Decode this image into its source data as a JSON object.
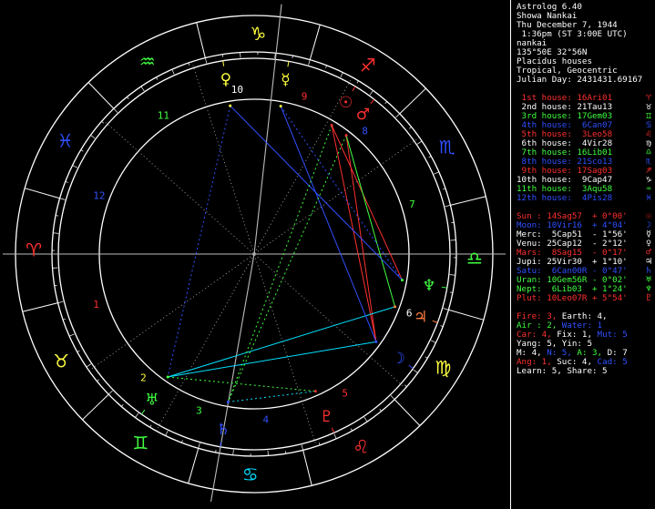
{
  "header": [
    "Astrolog 6.40",
    "Showa Nankai",
    "Thu December 7, 1944",
    " 1:36pm (ST 3:00E UTC)",
    "nankai",
    "135°50E 32°56N",
    "Placidus houses",
    "Tropical, Geocentric",
    "Julian Day: 2431431.69167"
  ],
  "houses": [
    {
      "text": " 1st house: 16Ari01",
      "color": "#ff3030",
      "glyph": "♈"
    },
    {
      "text": " 2nd house: 21Tau13",
      "color": "#ffffff",
      "glyph": "♉"
    },
    {
      "text": " 3rd house: 17Gem03",
      "color": "#40ff40",
      "glyph": "♊"
    },
    {
      "text": " 4th house:  6Can07",
      "color": "#3050ff",
      "glyph": "♋"
    },
    {
      "text": " 5th house:  3Leo58",
      "color": "#ff3030",
      "glyph": "♌"
    },
    {
      "text": " 6th house:  4Vir28",
      "color": "#ffffff",
      "glyph": "♍"
    },
    {
      "text": " 7th house: 16Lib01",
      "color": "#40ff40",
      "glyph": "♎"
    },
    {
      "text": " 8th house: 21Sco13",
      "color": "#3050ff",
      "glyph": "♏"
    },
    {
      "text": " 9th house: 17Sag03",
      "color": "#ff3030",
      "glyph": "♐"
    },
    {
      "text": "10th house:  9Cap47",
      "color": "#ffffff",
      "glyph": "♑"
    },
    {
      "text": "11th house:  3Aqu58",
      "color": "#40ff40",
      "glyph": "♒"
    },
    {
      "text": "12th house:  4Pis28",
      "color": "#3050ff",
      "glyph": "♓"
    }
  ],
  "planets": [
    {
      "text": "Sun : 14Sag57  + 0°00'",
      "color": "#ff3030",
      "glyph": "☉"
    },
    {
      "text": "Moon: 10Vir16  + 4°04'",
      "color": "#3050ff",
      "glyph": "☽"
    },
    {
      "text": "Merc:  5Cap51  - 1°56'",
      "color": "#ffffff",
      "glyph": "☿"
    },
    {
      "text": "Venu: 25Cap12  - 2°12'",
      "color": "#ffffff",
      "glyph": "♀"
    },
    {
      "text": "Mars:  8Sag15  - 0°17'",
      "color": "#ff3030",
      "glyph": "♂"
    },
    {
      "text": "Jupi: 25Vir30  + 1°10'",
      "color": "#ffffff",
      "glyph": "♃"
    },
    {
      "text": "Satu:  6Can00R - 0°47'",
      "color": "#3050ff",
      "glyph": "♄"
    },
    {
      "text": "Uran: 10Gem56R - 0°02'",
      "color": "#40ff40",
      "glyph": "♅"
    },
    {
      "text": "Nept:  6Lib03  + 1°24'",
      "color": "#40ff40",
      "glyph": "♆"
    },
    {
      "text": "Plut: 10Leo07R + 5°54'",
      "color": "#ff3030",
      "glyph": "♇"
    }
  ],
  "elements": [
    {
      "parts": [
        {
          "t": "Fire: 3, ",
          "c": "#ff3030"
        },
        {
          "t": "Earth: 4,",
          "c": "#ffffff"
        }
      ]
    },
    {
      "parts": [
        {
          "t": "Air : 2, ",
          "c": "#40ff40"
        },
        {
          "t": "Water: 1",
          "c": "#3050ff"
        }
      ]
    },
    {
      "parts": [
        {
          "t": "Car: 4, ",
          "c": "#ff3030"
        },
        {
          "t": "Fix: 1, ",
          "c": "#ffffff"
        },
        {
          "t": "Mut: 5",
          "c": "#3050ff"
        }
      ]
    },
    {
      "parts": [
        {
          "t": "Yang: 5, Yin: 5",
          "c": "#ffffff"
        }
      ]
    },
    {
      "parts": [
        {
          "t": "M: 4, ",
          "c": "#ffffff"
        },
        {
          "t": "N: 5, ",
          "c": "#3050ff"
        },
        {
          "t": "A: 3, ",
          "c": "#40ff40"
        },
        {
          "t": "D: 7",
          "c": "#ffffff"
        }
      ]
    },
    {
      "parts": [
        {
          "t": "Ang: 1, ",
          "c": "#ff3030"
        },
        {
          "t": "Suc: 4, ",
          "c": "#ffffff"
        },
        {
          "t": "Cad: 5",
          "c": "#3050ff"
        }
      ]
    },
    {
      "parts": [
        {
          "t": "Learn: 5, Share: 5",
          "c": "#ffffff"
        }
      ]
    }
  ],
  "wheel": {
    "signs": [
      {
        "glyph": "♈",
        "color": "#ff3030"
      },
      {
        "glyph": "♉",
        "color": "#ffff40"
      },
      {
        "glyph": "♊",
        "color": "#40ff40"
      },
      {
        "glyph": "♋",
        "color": "#00e0ff"
      },
      {
        "glyph": "♌",
        "color": "#ff3030"
      },
      {
        "glyph": "♍",
        "color": "#ffff40"
      },
      {
        "glyph": "♎",
        "color": "#40ff40"
      },
      {
        "glyph": "♏",
        "color": "#3050ff"
      },
      {
        "glyph": "♐",
        "color": "#ff3030"
      },
      {
        "glyph": "♑",
        "color": "#ffff40"
      },
      {
        "glyph": "♒",
        "color": "#40ff40"
      },
      {
        "glyph": "♓",
        "color": "#3050ff"
      }
    ],
    "house_numbers": [
      {
        "n": "1",
        "color": "#ff3030"
      },
      {
        "n": "2",
        "color": "#ffff40"
      },
      {
        "n": "3",
        "color": "#40ff40"
      },
      {
        "n": "4",
        "color": "#3050ff"
      },
      {
        "n": "5",
        "color": "#ff3030"
      },
      {
        "n": "6",
        "color": "#ffffff"
      },
      {
        "n": "7",
        "color": "#40ff40"
      },
      {
        "n": "8",
        "color": "#3050ff"
      },
      {
        "n": "9",
        "color": "#ff3030"
      },
      {
        "n": "10",
        "color": "#ffffff"
      },
      {
        "n": "11",
        "color": "#40ff40"
      },
      {
        "n": "12",
        "color": "#3050ff"
      }
    ],
    "planets": [
      {
        "name": "Sun",
        "glyph": "☉",
        "color": "#ff3030",
        "lon": 254.95
      },
      {
        "name": "Moon",
        "glyph": "☽",
        "color": "#3050ff",
        "lon": 160.27
      },
      {
        "name": "Mercury",
        "glyph": "☿",
        "color": "#ffff40",
        "lon": 275.85
      },
      {
        "name": "Venus",
        "glyph": "♀",
        "color": "#ffff40",
        "lon": 295.2
      },
      {
        "name": "Mars",
        "glyph": "♂",
        "color": "#ff3030",
        "lon": 248.25
      },
      {
        "name": "Jupiter",
        "glyph": "♃",
        "color": "#ff8040",
        "lon": 175.5
      },
      {
        "name": "Saturn",
        "glyph": "♄",
        "color": "#3050ff",
        "lon": 96.0
      },
      {
        "name": "Uranus",
        "glyph": "♅",
        "color": "#40ff40",
        "lon": 70.93
      },
      {
        "name": "Neptune",
        "glyph": "♆",
        "color": "#40ff40",
        "lon": 186.05
      },
      {
        "name": "Pluto",
        "glyph": "♇",
        "color": "#ff3030",
        "lon": 130.12
      }
    ]
  },
  "chart_data": {
    "type": "table",
    "ascendant_lon": 16.02,
    "house_cusps_lon": [
      16.02,
      51.22,
      77.05,
      96.12,
      123.97,
      154.47,
      196.02,
      231.22,
      257.05,
      279.78,
      303.97,
      334.47
    ],
    "aspects": [
      {
        "a": "Sun",
        "b": "Moon",
        "color": "#ff3030",
        "dashed": false
      },
      {
        "a": "Sun",
        "b": "Neptune",
        "color": "#ff3030",
        "dashed": false
      },
      {
        "a": "Mars",
        "b": "Moon",
        "color": "#ff3030",
        "dashed": false
      },
      {
        "a": "Mars",
        "b": "Jupiter",
        "color": "#40ff40",
        "dashed": false
      },
      {
        "a": "Moon",
        "b": "Uranus",
        "color": "#00e0ff",
        "dashed": false
      },
      {
        "a": "Uranus",
        "b": "Jupiter",
        "color": "#00e0ff",
        "dashed": false
      },
      {
        "a": "Venus",
        "b": "Neptune",
        "color": "#3050ff",
        "dashed": false
      },
      {
        "a": "Mercury",
        "b": "Moon",
        "color": "#3050ff",
        "dashed": false
      },
      {
        "a": "Sun",
        "b": "Saturn",
        "color": "#40ff40",
        "dashed": true
      },
      {
        "a": "Mars",
        "b": "Saturn",
        "color": "#40ff40",
        "dashed": true
      },
      {
        "a": "Uranus",
        "b": "Pluto",
        "color": "#40ff40",
        "dashed": true
      },
      {
        "a": "Saturn",
        "b": "Pluto",
        "color": "#00e0ff",
        "dashed": true
      },
      {
        "a": "Venus",
        "b": "Uranus",
        "color": "#3050ff",
        "dashed": true
      },
      {
        "a": "Mercury",
        "b": "Neptune",
        "color": "#3050ff",
        "dashed": true
      }
    ]
  }
}
